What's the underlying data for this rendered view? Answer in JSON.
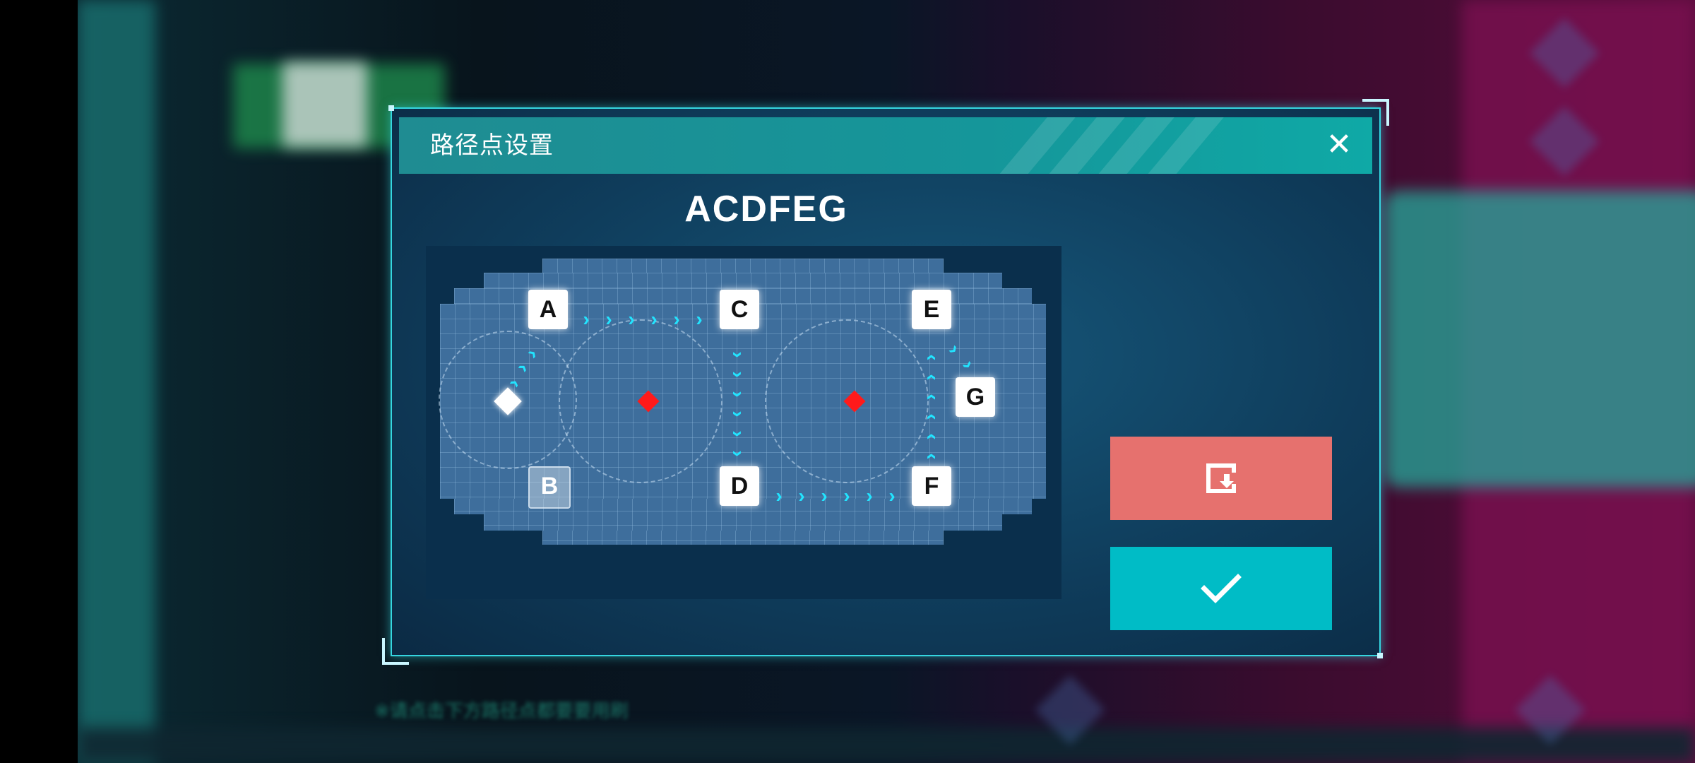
{
  "dialog": {
    "title": "路径点设置",
    "close_label": "✕",
    "route_label": "ACDFEG"
  },
  "map": {
    "nodes": [
      {
        "id": "A",
        "label": "A",
        "active": true
      },
      {
        "id": "B",
        "label": "B",
        "active": false
      },
      {
        "id": "C",
        "label": "C",
        "active": true
      },
      {
        "id": "D",
        "label": "D",
        "active": true
      },
      {
        "id": "E",
        "label": "E",
        "active": true
      },
      {
        "id": "F",
        "label": "F",
        "active": true
      },
      {
        "id": "G",
        "label": "G",
        "active": true
      }
    ],
    "path_order": [
      "A",
      "C",
      "D",
      "F",
      "E",
      "G"
    ]
  },
  "buttons": {
    "reset_icon": "reset-exit-icon",
    "confirm_icon": "checkmark-icon"
  },
  "background": {
    "hint_text": "※请点击下方路径点都要要用刷"
  },
  "colors": {
    "accent": "#35d6e0",
    "title_bar": "#15969a",
    "reset_button": "#e6716e",
    "confirm_button": "#00bcc6",
    "path_arrow": "#22e4ff",
    "marker": "#ff1a1a"
  }
}
